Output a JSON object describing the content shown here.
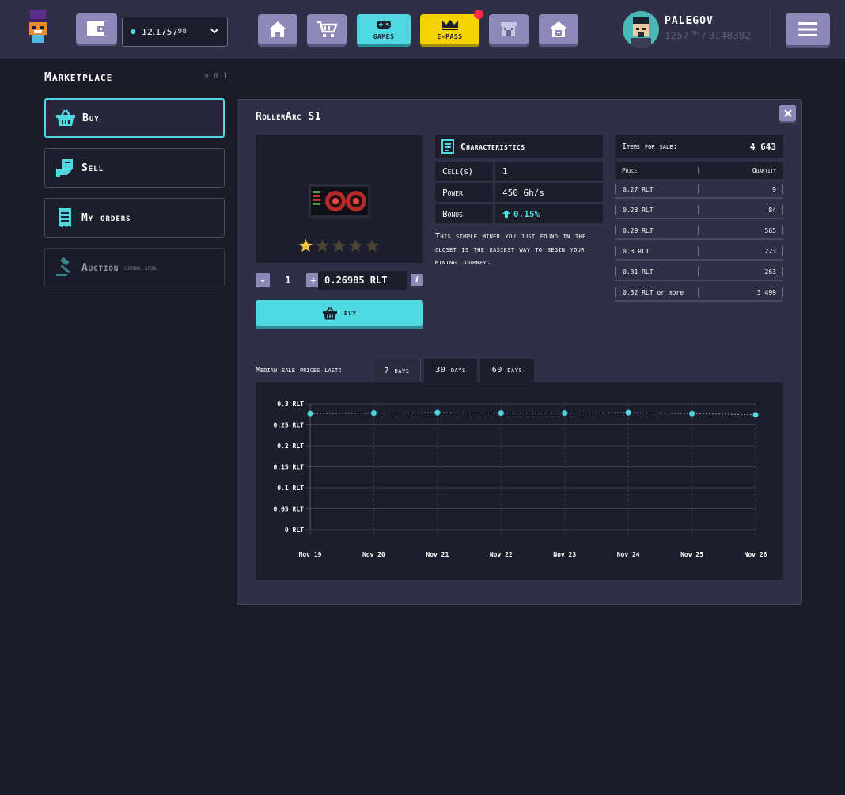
{
  "header": {
    "balance_main": "12.1757",
    "balance_small": "98",
    "nav": [
      {
        "id": "home",
        "icon": "home-icon"
      },
      {
        "id": "market",
        "icon": "cart-icon"
      },
      {
        "id": "games",
        "label": "GAMES",
        "icon": "gamepad-icon"
      },
      {
        "id": "epass",
        "label": "E-PASS",
        "icon": "crown-icon"
      },
      {
        "id": "store",
        "icon": "store-icon"
      },
      {
        "id": "room",
        "icon": "house-icon"
      }
    ],
    "user": {
      "name": "PALEGOV",
      "rank": "1257",
      "rank_suffix": "TH",
      "rank_total": "/ 3148382"
    }
  },
  "sidebar": {
    "title": "Marketplace",
    "version": "v 0.1",
    "items": [
      {
        "label": "Buy",
        "icon": "basket-icon",
        "active": true
      },
      {
        "label": "Sell",
        "icon": "sell-icon"
      },
      {
        "label": "My orders",
        "icon": "receipt-icon"
      },
      {
        "label": "Auction",
        "note": "coming soon",
        "icon": "gavel-icon",
        "disabled": true
      }
    ]
  },
  "item": {
    "title": "RollerArc S1",
    "rating": 1,
    "rating_max": 5,
    "quantity": "1",
    "price": "0.26985 RLT",
    "buy_label": "buy",
    "characteristics_title": "Characteristics",
    "characteristics": [
      {
        "key": "Cell(s)",
        "value": "1"
      },
      {
        "key": "Power",
        "value": "450 Gh/s"
      },
      {
        "key": "Bonus",
        "value": "0.15%"
      }
    ],
    "description": "This simple miner you just found in the closet is the easiest way to begin your mining journey."
  },
  "sales": {
    "label": "Items for sale:",
    "count": "4 643",
    "col_price": "Price",
    "col_qty": "Quantity",
    "rows": [
      {
        "price": "0.27 RLT",
        "qty": "9"
      },
      {
        "price": "0.28 RLT",
        "qty": "84"
      },
      {
        "price": "0.29 RLT",
        "qty": "565"
      },
      {
        "price": "0.3 RLT",
        "qty": "223"
      },
      {
        "price": "0.31 RLT",
        "qty": "263"
      },
      {
        "price": "0.32 RLT or more",
        "qty": "3 499"
      }
    ]
  },
  "history": {
    "label": "Median sale prices last:",
    "tabs": [
      {
        "label": "7 days",
        "active": true
      },
      {
        "label": "30 days"
      },
      {
        "label": "60 days"
      }
    ]
  },
  "colors": {
    "accent": "#4fd8df",
    "violet": "#8d88b8",
    "epass": "#f5d300",
    "background": "#1a1b27",
    "panel": "#2f3045"
  },
  "chart_data": {
    "type": "line",
    "categories": [
      "Nov 19",
      "Nov 20",
      "Nov 21",
      "Nov 22",
      "Nov 23",
      "Nov 24",
      "Nov 25",
      "Nov 26"
    ],
    "series": [
      {
        "values": [
          0.277,
          0.278,
          0.279,
          0.278,
          0.278,
          0.279,
          0.277,
          0.274
        ]
      }
    ],
    "yticks": [
      "0 RLT",
      "0.05 RLT",
      "0.1 RLT",
      "0.15 RLT",
      "0.2 RLT",
      "0.25 RLT",
      "0.3 RLT"
    ],
    "ylim": [
      0,
      0.3
    ],
    "grid": true
  }
}
